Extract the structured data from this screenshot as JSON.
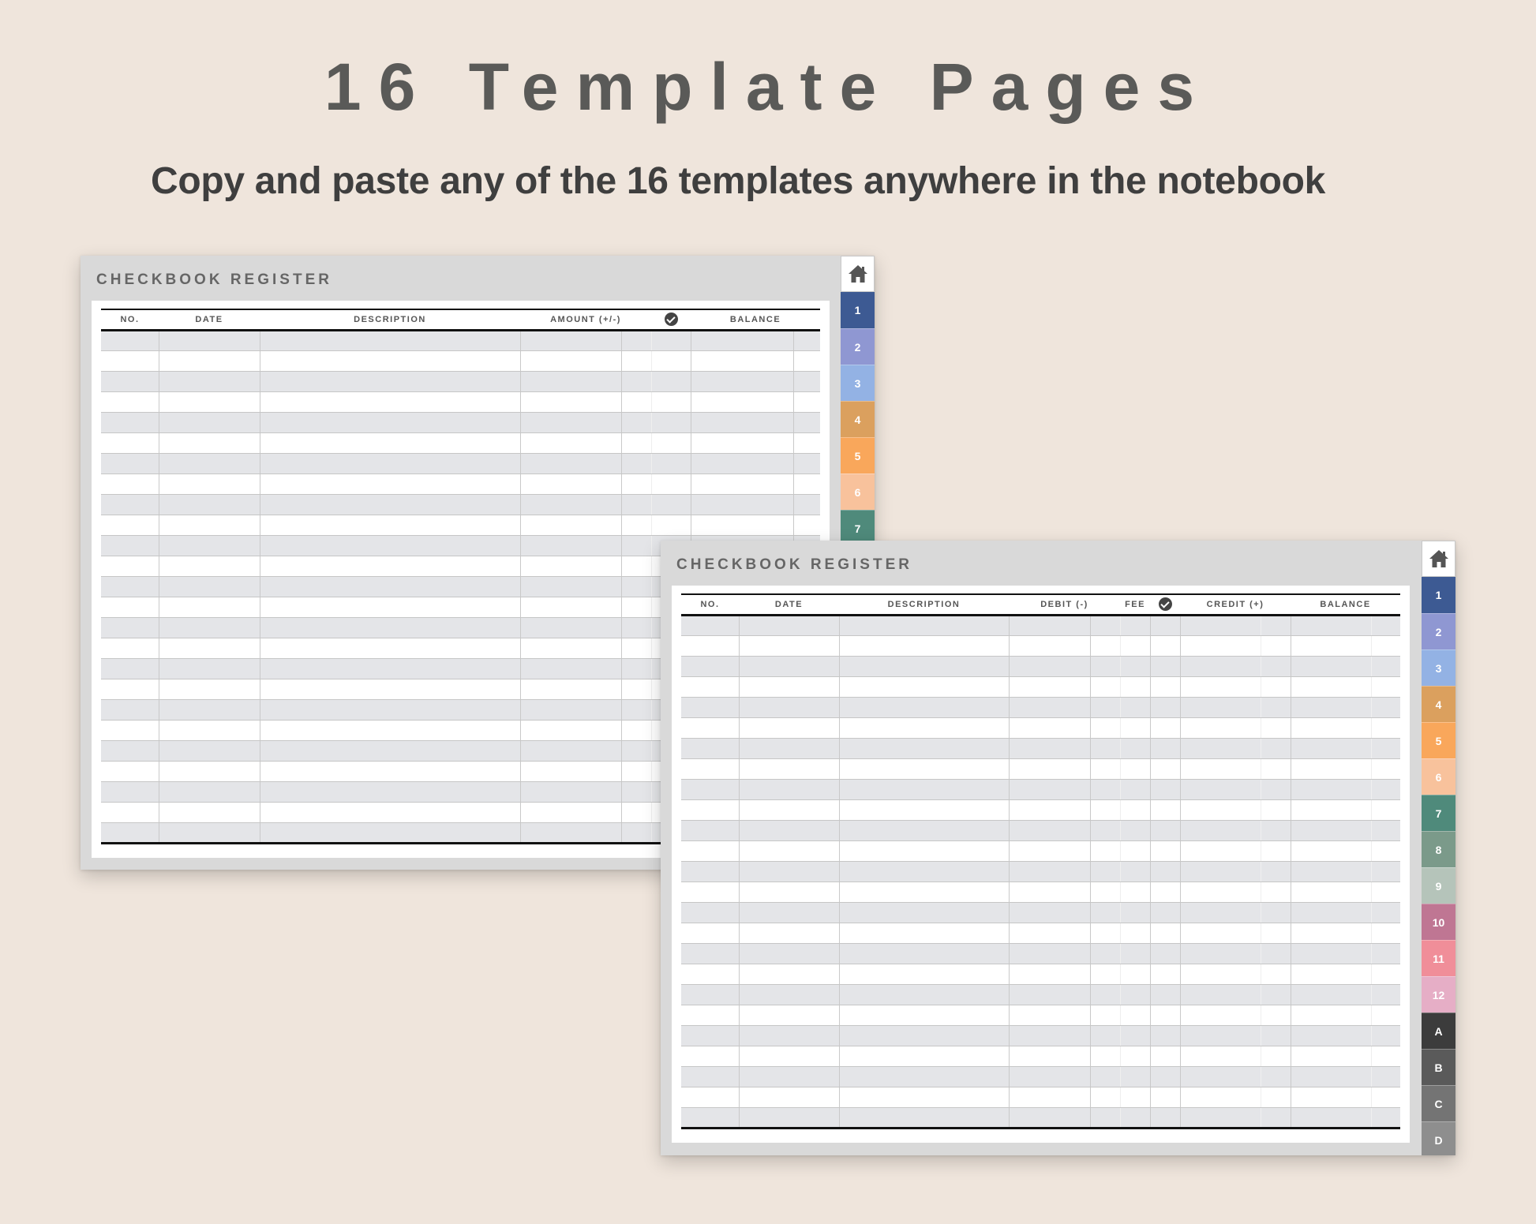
{
  "header": {
    "title": "16 Template Pages",
    "subtitle": "Copy and paste any of the 16 templates anywhere in the notebook"
  },
  "pages": [
    {
      "title": "CHECKBOOK REGISTER",
      "columns": [
        "NO.",
        "DATE",
        "DESCRIPTION",
        "AMOUNT (+/-)",
        "check-icon",
        "BALANCE"
      ],
      "tabs": [
        {
          "label": "1",
          "color": "#3d5a93"
        },
        {
          "label": "2",
          "color": "#8f97d2"
        },
        {
          "label": "3",
          "color": "#93b2e4"
        },
        {
          "label": "4",
          "color": "#dba05e"
        },
        {
          "label": "5",
          "color": "#f9a75b"
        },
        {
          "label": "6",
          "color": "#f8c29c"
        },
        {
          "label": "7",
          "color": "#4f8a7b"
        }
      ]
    },
    {
      "title": "CHECKBOOK REGISTER",
      "columns": [
        "NO.",
        "DATE",
        "DESCRIPTION",
        "DEBIT (-)",
        "FEE",
        "check-icon",
        "CREDIT (+)",
        "BALANCE"
      ],
      "tabs": [
        {
          "label": "1",
          "color": "#3d5a93"
        },
        {
          "label": "2",
          "color": "#8f97d2"
        },
        {
          "label": "3",
          "color": "#93b2e4"
        },
        {
          "label": "4",
          "color": "#dba05e"
        },
        {
          "label": "5",
          "color": "#f9a75b"
        },
        {
          "label": "6",
          "color": "#f8c29c"
        },
        {
          "label": "7",
          "color": "#4f8a7b"
        },
        {
          "label": "8",
          "color": "#7b9a8a"
        },
        {
          "label": "9",
          "color": "#b5c4ba"
        },
        {
          "label": "10",
          "color": "#bf7693"
        },
        {
          "label": "11",
          "color": "#f08e99"
        },
        {
          "label": "12",
          "color": "#e6aec6"
        },
        {
          "label": "A",
          "color": "#3c3c3c"
        },
        {
          "label": "B",
          "color": "#5a5a5a"
        },
        {
          "label": "C",
          "color": "#747474"
        },
        {
          "label": "D",
          "color": "#8e8e8e"
        }
      ]
    }
  ]
}
